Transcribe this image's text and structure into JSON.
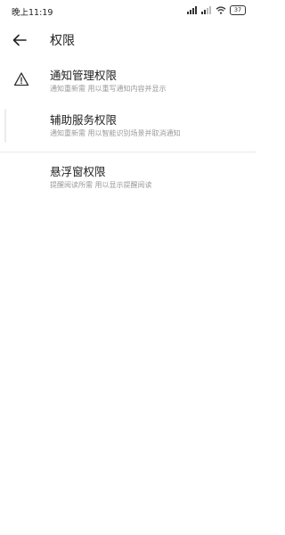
{
  "status_bar": {
    "time": "晚上11:19",
    "battery": "37"
  },
  "header": {
    "title": "权限"
  },
  "permissions": [
    {
      "title": "通知管理权限",
      "description": "通知重新需 用以重写通知内容并显示",
      "icon": "warning-icon"
    },
    {
      "title": "辅助服务权限",
      "description": "通知重新需 用以智能识别场景并取消通知",
      "icon": ""
    },
    {
      "title": "悬浮窗权限",
      "description": "提醒阅读所需 用以显示提醒阅读",
      "icon": ""
    }
  ]
}
